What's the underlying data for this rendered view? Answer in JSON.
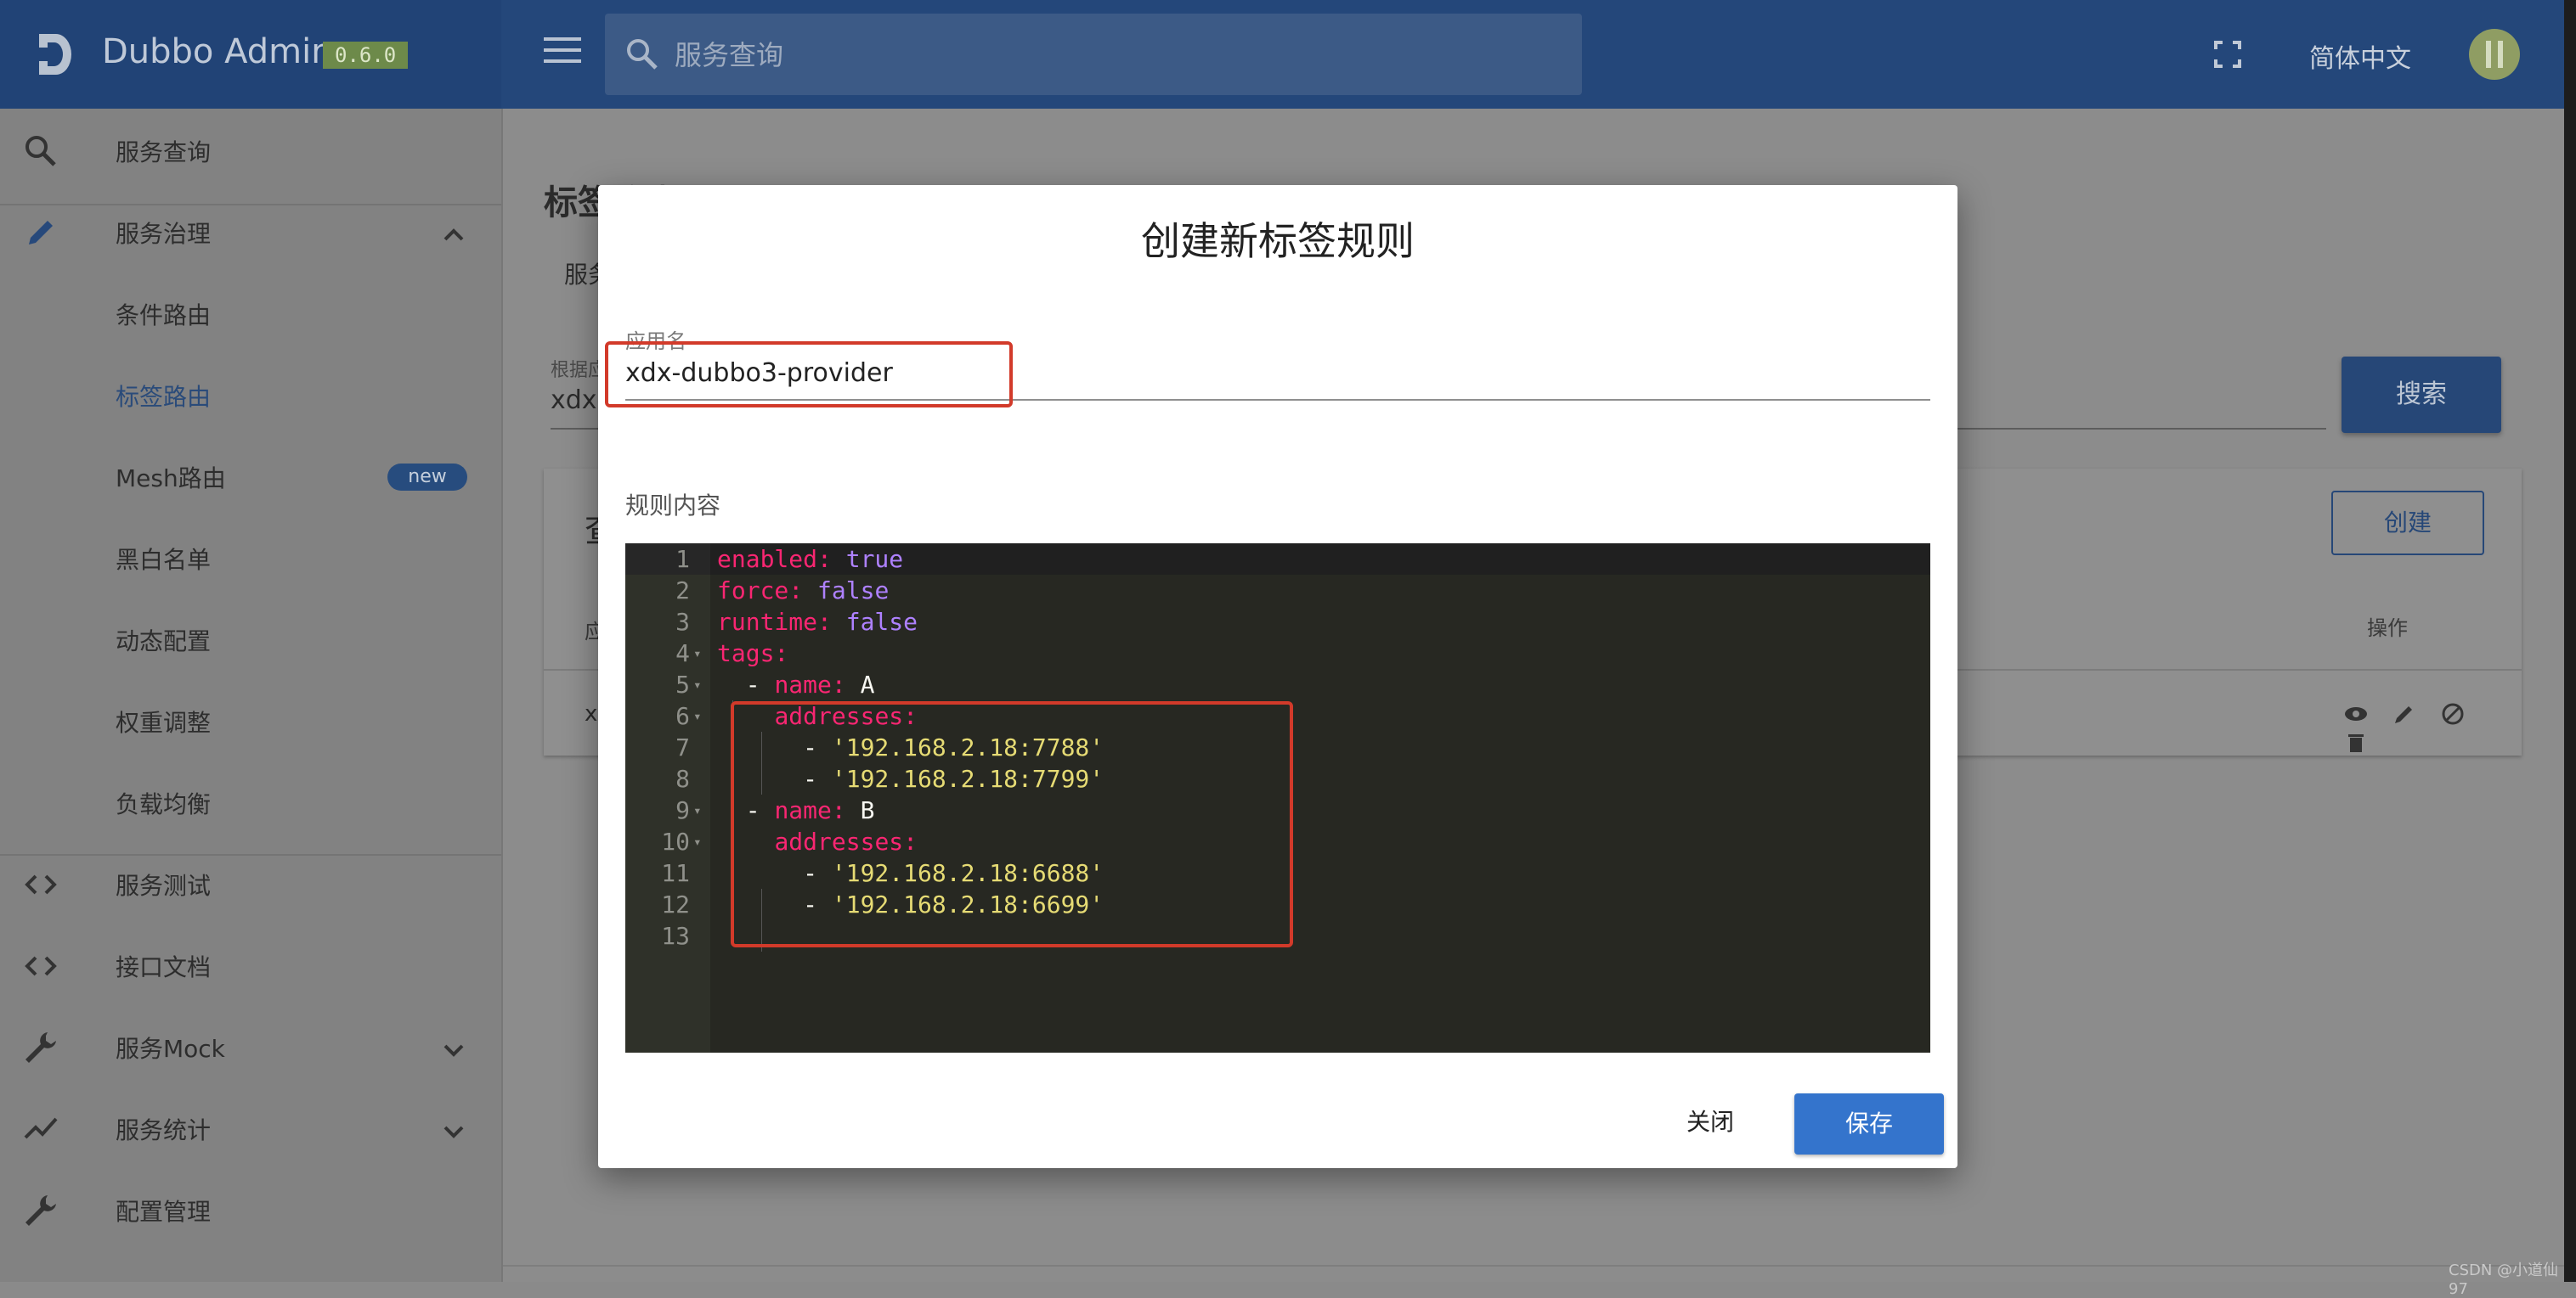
{
  "header": {
    "brand": "Dubbo Admin",
    "version": "0.6.0",
    "search_placeholder": "服务查询",
    "language": "简体中文"
  },
  "sidebar": {
    "items": [
      {
        "label": "服务查询",
        "icon": "search-icon"
      },
      {
        "label": "服务治理",
        "icon": "pencil-icon",
        "expanded": true
      },
      {
        "label": "条件路由"
      },
      {
        "label": "标签路由",
        "active": true
      },
      {
        "label": "Mesh路由",
        "badge": "new"
      },
      {
        "label": "黑白名单"
      },
      {
        "label": "动态配置"
      },
      {
        "label": "权重调整"
      },
      {
        "label": "负载均衡"
      },
      {
        "label": "服务测试",
        "icon": "code-icon"
      },
      {
        "label": "接口文档",
        "icon": "code-icon"
      },
      {
        "label": "服务Mock",
        "icon": "wrench-icon"
      },
      {
        "label": "服务统计",
        "icon": "chart-line-icon"
      },
      {
        "label": "配置管理",
        "icon": "wrench-icon"
      }
    ]
  },
  "background": {
    "page_title": "标签路由",
    "crumb": "服务",
    "search_label": "根据应",
    "search_value": "xdx-",
    "search_button": "搜索",
    "card_title": "查",
    "create_button": "创建",
    "col_left": "应",
    "col_actions": "操作",
    "row_cell": "x"
  },
  "dialog": {
    "title": "创建新标签规则",
    "app_label": "应用名",
    "app_value": "xdx-dubbo3-provider",
    "rule_label": "规则内容",
    "close_button": "关闭",
    "save_button": "保存",
    "code_lines": [
      {
        "n": "1",
        "fold": false,
        "parts": [
          {
            "t": "enabled: ",
            "c": "k"
          },
          {
            "t": "true",
            "c": "b"
          }
        ]
      },
      {
        "n": "2",
        "fold": false,
        "parts": [
          {
            "t": "force: ",
            "c": "k"
          },
          {
            "t": "false",
            "c": "b"
          }
        ]
      },
      {
        "n": "3",
        "fold": false,
        "parts": [
          {
            "t": "runtime: ",
            "c": "k"
          },
          {
            "t": "false",
            "c": "b"
          }
        ]
      },
      {
        "n": "4",
        "fold": true,
        "parts": [
          {
            "t": "tags:",
            "c": "k"
          }
        ]
      },
      {
        "n": "5",
        "fold": true,
        "parts": [
          {
            "t": "  - ",
            "c": ""
          },
          {
            "t": "name: ",
            "c": "k"
          },
          {
            "t": "A",
            "c": ""
          }
        ]
      },
      {
        "n": "6",
        "fold": true,
        "parts": [
          {
            "t": "    ",
            "c": ""
          },
          {
            "t": "addresses:",
            "c": "k"
          }
        ]
      },
      {
        "n": "7",
        "fold": false,
        "parts": [
          {
            "t": "      - ",
            "c": ""
          },
          {
            "t": "'192.168.2.18:7788'",
            "c": "s"
          }
        ]
      },
      {
        "n": "8",
        "fold": false,
        "parts": [
          {
            "t": "      - ",
            "c": ""
          },
          {
            "t": "'192.168.2.18:7799'",
            "c": "s"
          }
        ]
      },
      {
        "n": "9",
        "fold": true,
        "parts": [
          {
            "t": "  - ",
            "c": ""
          },
          {
            "t": "name: ",
            "c": "k"
          },
          {
            "t": "B",
            "c": ""
          }
        ]
      },
      {
        "n": "10",
        "fold": true,
        "parts": [
          {
            "t": "    ",
            "c": ""
          },
          {
            "t": "addresses:",
            "c": "k"
          }
        ]
      },
      {
        "n": "11",
        "fold": false,
        "parts": [
          {
            "t": "      - ",
            "c": ""
          },
          {
            "t": "'192.168.2.18:6688'",
            "c": "s"
          }
        ]
      },
      {
        "n": "12",
        "fold": false,
        "parts": [
          {
            "t": "      - ",
            "c": ""
          },
          {
            "t": "'192.168.2.18:6699'",
            "c": "s"
          }
        ]
      },
      {
        "n": "13",
        "fold": false,
        "parts": []
      }
    ]
  },
  "watermark": "CSDN @小道仙97",
  "colors": {
    "header": "#24477a",
    "accent": "#3474cc",
    "highlight": "#d23a2a",
    "editor_bg": "#272822"
  }
}
